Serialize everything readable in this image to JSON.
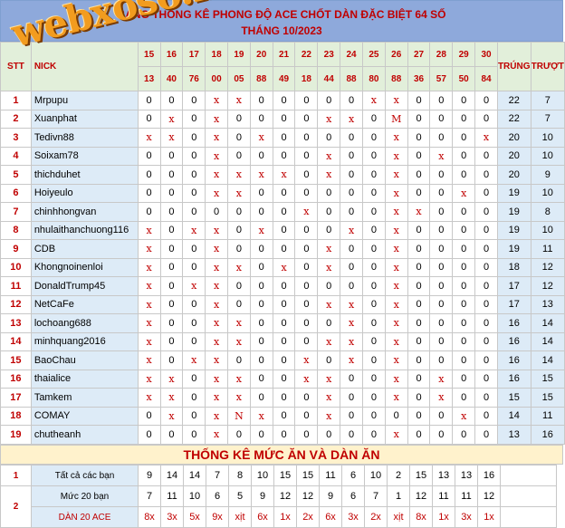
{
  "title": {
    "line1": "BẢNG THỐNG KÊ PHONG ĐỘ ACE CHỐT DÀN ĐẶC BIỆT 64 SỐ",
    "line2": "THÁNG 10/2023"
  },
  "logo": "webxoso.net",
  "header": {
    "stt": "STT",
    "nick": "NICK",
    "trung": "TRÚNG",
    "truot": "TRƯỢT",
    "days": [
      "15",
      "16",
      "17",
      "18",
      "19",
      "20",
      "21",
      "22",
      "23",
      "24",
      "25",
      "26",
      "27",
      "28",
      "29",
      "30"
    ],
    "results": [
      "13",
      "40",
      "76",
      "00",
      "05",
      "88",
      "49",
      "18",
      "44",
      "88",
      "80",
      "88",
      "36",
      "57",
      "50",
      "84"
    ]
  },
  "rows": [
    {
      "stt": "1",
      "nick": "Mrpupu",
      "v": [
        "0",
        "0",
        "0",
        "x",
        "x",
        "0",
        "0",
        "0",
        "0",
        "0",
        "x",
        "x",
        "0",
        "0",
        "0",
        "0"
      ],
      "trung": "22",
      "truot": "7"
    },
    {
      "stt": "2",
      "nick": "Xuanphat",
      "v": [
        "0",
        "x",
        "0",
        "x",
        "0",
        "0",
        "0",
        "0",
        "x",
        "x",
        "0",
        "M",
        "0",
        "0",
        "0",
        "0"
      ],
      "trung": "22",
      "truot": "7"
    },
    {
      "stt": "3",
      "nick": "Tedivn88",
      "v": [
        "x",
        "x",
        "0",
        "x",
        "0",
        "x",
        "0",
        "0",
        "0",
        "0",
        "0",
        "x",
        "0",
        "0",
        "0",
        "x"
      ],
      "trung": "20",
      "truot": "10"
    },
    {
      "stt": "4",
      "nick": "Soixam78",
      "v": [
        "0",
        "0",
        "0",
        "x",
        "0",
        "0",
        "0",
        "0",
        "x",
        "0",
        "0",
        "x",
        "0",
        "x",
        "0",
        "0"
      ],
      "trung": "20",
      "truot": "10"
    },
    {
      "stt": "5",
      "nick": "thichduhet",
      "v": [
        "0",
        "0",
        "0",
        "x",
        "x",
        "x",
        "x",
        "0",
        "x",
        "0",
        "0",
        "x",
        "0",
        "0",
        "0",
        "0"
      ],
      "trung": "20",
      "truot": "9"
    },
    {
      "stt": "6",
      "nick": "Hoiyeulo",
      "v": [
        "0",
        "0",
        "0",
        "x",
        "x",
        "0",
        "0",
        "0",
        "0",
        "0",
        "0",
        "x",
        "0",
        "0",
        "x",
        "0"
      ],
      "trung": "19",
      "truot": "10"
    },
    {
      "stt": "7",
      "nick": "chinhhongvan",
      "v": [
        "0",
        "0",
        "0",
        "0",
        "0",
        "0",
        "0",
        "x",
        "0",
        "0",
        "0",
        "x",
        "x",
        "0",
        "0",
        "0"
      ],
      "trung": "19",
      "truot": "8"
    },
    {
      "stt": "8",
      "nick": "nhulaithanchuong116",
      "v": [
        "x",
        "0",
        "x",
        "x",
        "0",
        "x",
        "0",
        "0",
        "0",
        "x",
        "0",
        "x",
        "0",
        "0",
        "0",
        "0"
      ],
      "trung": "19",
      "truot": "10"
    },
    {
      "stt": "9",
      "nick": "CDB",
      "v": [
        "x",
        "0",
        "0",
        "x",
        "0",
        "0",
        "0",
        "0",
        "x",
        "0",
        "0",
        "x",
        "0",
        "0",
        "0",
        "0"
      ],
      "trung": "19",
      "truot": "11"
    },
    {
      "stt": "10",
      "nick": "Khongnoinenloi",
      "v": [
        "x",
        "0",
        "0",
        "x",
        "x",
        "0",
        "x",
        "0",
        "x",
        "0",
        "0",
        "x",
        "0",
        "0",
        "0",
        "0"
      ],
      "trung": "18",
      "truot": "12"
    },
    {
      "stt": "11",
      "nick": "DonaldTrump45",
      "v": [
        "x",
        "0",
        "x",
        "x",
        "0",
        "0",
        "0",
        "0",
        "0",
        "0",
        "0",
        "x",
        "0",
        "0",
        "0",
        "0"
      ],
      "trung": "17",
      "truot": "12"
    },
    {
      "stt": "12",
      "nick": "NetCaFe",
      "v": [
        "x",
        "0",
        "0",
        "x",
        "0",
        "0",
        "0",
        "0",
        "x",
        "x",
        "0",
        "x",
        "0",
        "0",
        "0",
        "0"
      ],
      "trung": "17",
      "truot": "13"
    },
    {
      "stt": "13",
      "nick": "lochoang688",
      "v": [
        "x",
        "0",
        "0",
        "x",
        "x",
        "0",
        "0",
        "0",
        "0",
        "x",
        "0",
        "x",
        "0",
        "0",
        "0",
        "0"
      ],
      "trung": "16",
      "truot": "14"
    },
    {
      "stt": "14",
      "nick": "minhquang2016",
      "v": [
        "x",
        "0",
        "0",
        "x",
        "x",
        "0",
        "0",
        "0",
        "x",
        "x",
        "0",
        "x",
        "0",
        "0",
        "0",
        "0"
      ],
      "trung": "16",
      "truot": "14"
    },
    {
      "stt": "15",
      "nick": "BaoChau",
      "v": [
        "x",
        "0",
        "x",
        "x",
        "0",
        "0",
        "0",
        "x",
        "0",
        "x",
        "0",
        "x",
        "0",
        "0",
        "0",
        "0"
      ],
      "trung": "16",
      "truot": "14"
    },
    {
      "stt": "16",
      "nick": "thaialice",
      "v": [
        "x",
        "x",
        "0",
        "x",
        "x",
        "0",
        "0",
        "x",
        "x",
        "0",
        "0",
        "x",
        "0",
        "x",
        "0",
        "0"
      ],
      "trung": "16",
      "truot": "15"
    },
    {
      "stt": "17",
      "nick": "Tamkem",
      "v": [
        "x",
        "x",
        "0",
        "x",
        "x",
        "0",
        "0",
        "0",
        "x",
        "0",
        "0",
        "x",
        "0",
        "x",
        "0",
        "0"
      ],
      "trung": "15",
      "truot": "15"
    },
    {
      "stt": "18",
      "nick": "COMAY",
      "v": [
        "0",
        "x",
        "0",
        "x",
        "N",
        "x",
        "0",
        "0",
        "x",
        "0",
        "0",
        "0",
        "0",
        "0",
        "x",
        "0"
      ],
      "trung": "14",
      "truot": "11"
    },
    {
      "stt": "19",
      "nick": "chutheanh",
      "v": [
        "0",
        "0",
        "0",
        "x",
        "0",
        "0",
        "0",
        "0",
        "0",
        "0",
        "0",
        "x",
        "0",
        "0",
        "0",
        "0"
      ],
      "trung": "13",
      "truot": "16"
    }
  ],
  "summary": {
    "title": "THỐNG KÊ MỨC ĂN VÀ DÀN ĂN",
    "row1": {
      "stt": "1",
      "label": "Tất cả các bạn",
      "v": [
        "9",
        "14",
        "14",
        "7",
        "8",
        "10",
        "15",
        "15",
        "11",
        "6",
        "10",
        "2",
        "15",
        "13",
        "13",
        "16"
      ]
    },
    "row2": {
      "stt": "2",
      "label": "Mức 20 bạn",
      "v": [
        "7",
        "11",
        "10",
        "6",
        "5",
        "9",
        "12",
        "12",
        "9",
        "6",
        "7",
        "1",
        "12",
        "11",
        "11",
        "12"
      ]
    },
    "row3": {
      "label": "DÀN 20 ACE",
      "v": [
        "8x",
        "3x",
        "5x",
        "9x",
        "xịt",
        "6x",
        "1x",
        "2x",
        "6x",
        "3x",
        "2x",
        "xịt",
        "8x",
        "1x",
        "3x",
        "1x"
      ]
    }
  },
  "colors": {
    "title_bg": "#8ea9db",
    "header_bg": "#e2efda",
    "nick_bg": "#ddebf7",
    "accent": "#c00000",
    "logo": "#f29c1f",
    "summary_bg": "#fff2cc"
  }
}
